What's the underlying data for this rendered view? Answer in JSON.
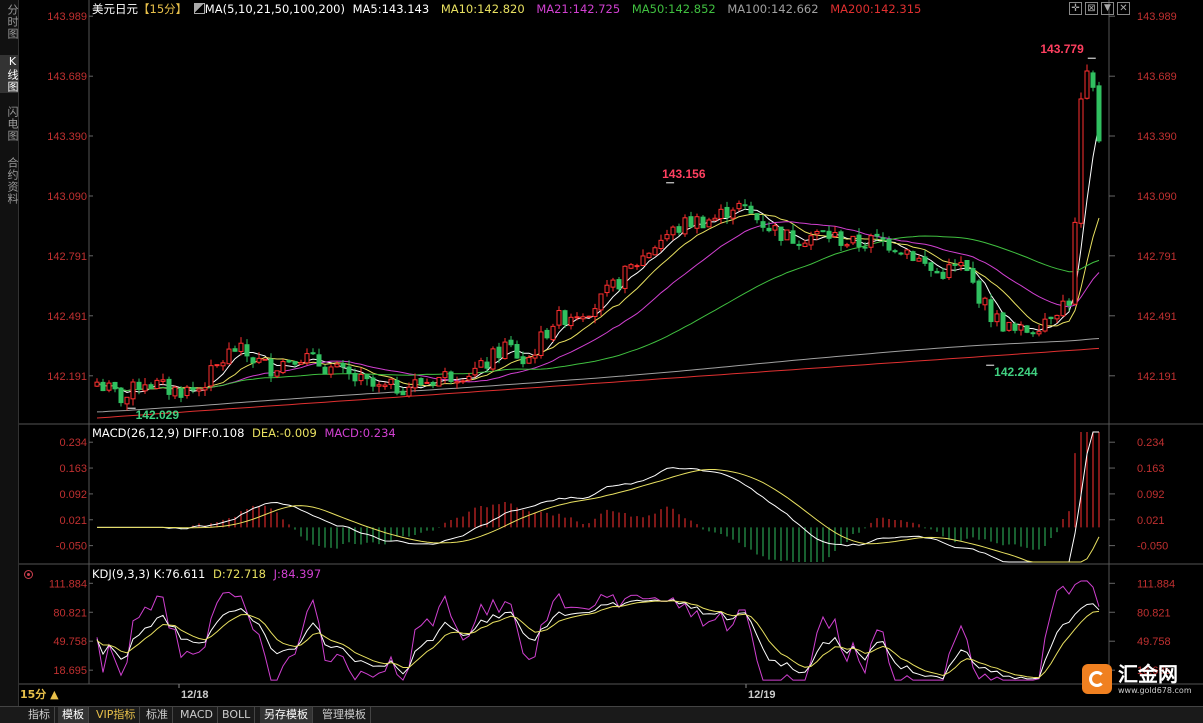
{
  "sidebar": {
    "tabs": [
      {
        "label": "分时图",
        "active": false
      },
      {
        "label": "K线图",
        "active": true
      },
      {
        "label": "闪电图",
        "active": false
      },
      {
        "label": "合约资料",
        "active": false
      }
    ]
  },
  "header": {
    "symbol": "美元日元",
    "period": "【15分】",
    "ma_spec": "MA(5,10,21,50,100,200)",
    "ma": [
      {
        "label": "MA5:143.143",
        "color": "#ffffff"
      },
      {
        "label": "MA10:142.820",
        "color": "#e8e060"
      },
      {
        "label": "MA21:142.725",
        "color": "#d040d0"
      },
      {
        "label": "MA50:142.852",
        "color": "#40c040"
      },
      {
        "label": "MA100:142.662",
        "color": "#a0a0a0"
      },
      {
        "label": "MA200:142.315",
        "color": "#e03030"
      }
    ]
  },
  "window_controls": [
    "plus-icon",
    "close-box-icon",
    "down-icon",
    "close-box-icon"
  ],
  "macd_header": {
    "name": "MACD(26,12,9)",
    "diff": "DIFF:0.108",
    "dea": "DEA:-0.009",
    "macd": "MACD:0.234"
  },
  "kdj_header": {
    "name": "KDJ(9,3,3)",
    "k": "K:76.611",
    "d": "D:72.718",
    "j": "J:84.397"
  },
  "period_label": "15分 ▲",
  "bottom_tabs": [
    {
      "label": "指标",
      "active": false,
      "vip": false
    },
    {
      "label": "模板",
      "active": true,
      "vip": false
    },
    {
      "label": "VIP指标",
      "active": false,
      "vip": true
    },
    {
      "label": "标准",
      "active": false,
      "vip": false
    },
    {
      "label": "MACD",
      "active": false,
      "vip": false
    },
    {
      "label": "BOLL",
      "active": false,
      "vip": false
    },
    {
      "label": "另存模板",
      "active": true,
      "vip": false
    },
    {
      "label": "管理模板",
      "active": false,
      "vip": false
    }
  ],
  "logo": {
    "text": "汇金网",
    "sub": "www.gold678.com"
  },
  "chart_data": [
    {
      "type": "candlestick",
      "yticks": [
        "143.989",
        "143.689",
        "143.390",
        "143.090",
        "142.791",
        "142.491",
        "142.191"
      ],
      "ylim": [
        141.96,
        144.06
      ],
      "x_labels": [
        "12/18",
        "12/19"
      ],
      "annotations": [
        {
          "text": "143.156",
          "value": 143.156,
          "kind": "high",
          "color": "#ff4060"
        },
        {
          "text": "143.779",
          "value": 143.779,
          "kind": "high",
          "color": "#ff4060"
        },
        {
          "text": "142.029",
          "value": 142.029,
          "kind": "low",
          "color": "#40d080"
        },
        {
          "text": "142.244",
          "value": 142.244,
          "kind": "low",
          "color": "#40d080"
        }
      ],
      "colors": {
        "up": "#ff3030",
        "down": "#30c060",
        "tick": "#e03040",
        "axis": "#c03030"
      }
    },
    {
      "type": "bar",
      "name": "MACD",
      "yticks": [
        "0.234",
        "0.163",
        "0.092",
        "0.021",
        "-0.050"
      ],
      "ylim": [
        -0.095,
        0.262
      ]
    },
    {
      "type": "line",
      "name": "KDJ",
      "yticks": [
        "111.884",
        "80.821",
        "49.758",
        "18.695"
      ],
      "ylim": [
        6.0,
        124.0
      ],
      "series_colors": {
        "K": "#ffffff",
        "D": "#e8e060",
        "J": "#d040d0"
      }
    }
  ]
}
